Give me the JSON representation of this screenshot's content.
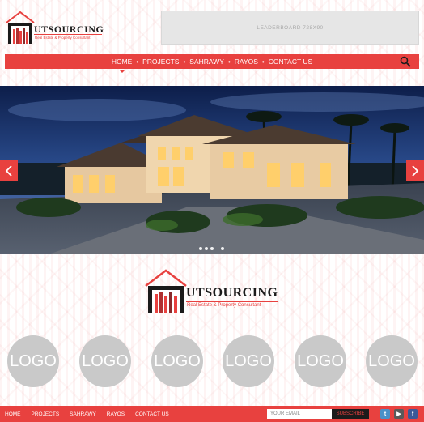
{
  "brand": {
    "name": "UTSOURCING",
    "tagline": "Real Estate & Property Consultant"
  },
  "leaderboard": {
    "label": "LEADERBOARD 728X90"
  },
  "nav": {
    "items": [
      {
        "label": "HOME",
        "active": true
      },
      {
        "label": "PROJECTS"
      },
      {
        "label": "SAHRAWY"
      },
      {
        "label": "RAYOS"
      },
      {
        "label": "CONTACT US"
      }
    ],
    "search_icon": "search-icon"
  },
  "slider": {
    "prev_icon": "chevron-left-icon",
    "next_icon": "chevron-right-icon",
    "dots": 4,
    "active_dot": 3
  },
  "partners": {
    "labels": [
      "LOGO",
      "LOGO",
      "LOGO",
      "LOGO",
      "LOGO",
      "LOGO"
    ]
  },
  "footer": {
    "nav": [
      "HOME",
      "PROJECTS",
      "SAHRAWY",
      "RAYOS",
      "CONTACT US"
    ],
    "email_placeholder": "YOUR EMAIL",
    "subscribe_label": "SUBSCRIBE",
    "social": [
      "twitter-icon",
      "youtube-icon",
      "facebook-icon"
    ]
  },
  "colors": {
    "accent": "#e8413f",
    "dark": "#1b1b1b",
    "logo_grey": "#c9c9c9"
  }
}
